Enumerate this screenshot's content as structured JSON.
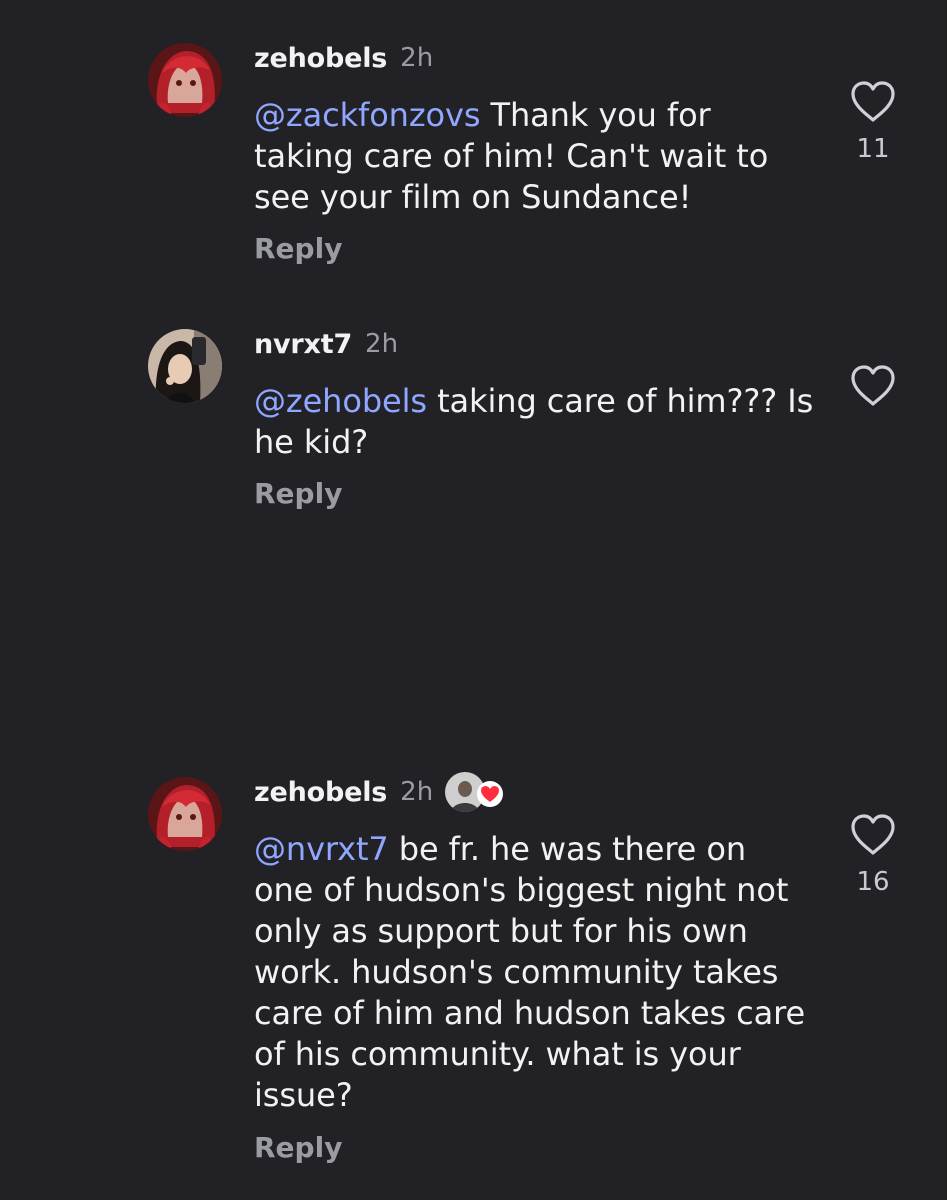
{
  "comments": [
    {
      "username": "zehobels",
      "time": "2h",
      "mention": "@zackfonzovs",
      "text": " Thank you for taking care of him! Can't wait to see your film on Sundance!",
      "reply_label": "Reply",
      "like_count": "11",
      "avatar_icon": "red-hair-avatar"
    },
    {
      "username": "nvrxt7",
      "time": "2h",
      "mention": "@zehobels",
      "text": " taking care of him??? Is he kid?",
      "reply_label": "Reply",
      "like_count": "",
      "avatar_icon": "selfie-avatar"
    },
    {
      "username": "zehobels",
      "time": "2h",
      "mention": "@nvrxt7",
      "text": " be fr. he was there on one of hudson's biggest night not only as support but for his own work. hudson's community takes care of him and hudson takes care of his community. what is your issue?",
      "reply_label": "Reply",
      "like_count": "16",
      "avatar_icon": "red-hair-avatar",
      "liked_by_author_icon": "author-like-heart-icon"
    }
  ],
  "colors": {
    "background": "#222226",
    "text": "#f2f2f2",
    "muted": "#9b9ba3",
    "mention": "#8fa7ff",
    "heart_badge": "#ff2d3f"
  }
}
